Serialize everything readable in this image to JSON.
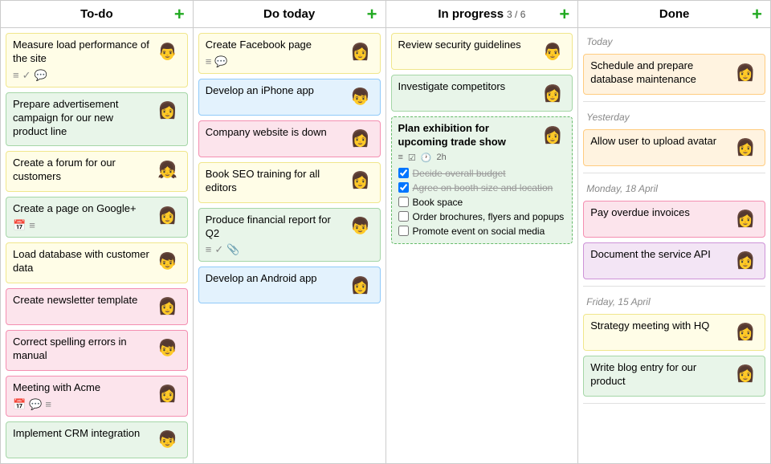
{
  "columns": [
    {
      "id": "todo",
      "label": "To-do",
      "badge": null,
      "cards": [
        {
          "id": "td1",
          "title": "Measure load performance of the site",
          "color": "yellow",
          "icons": [
            "list",
            "check",
            "bubble"
          ],
          "avatar": "👨"
        },
        {
          "id": "td2",
          "title": "Prepare advertisement campaign for our new product line",
          "color": "green",
          "icons": [],
          "avatar": "👩"
        },
        {
          "id": "td3",
          "title": "Create a forum for our customers",
          "color": "yellow",
          "icons": [],
          "avatar": "👧"
        },
        {
          "id": "td4",
          "title": "Create a page on Google+",
          "color": "green",
          "icons": [
            "calendar",
            "list"
          ],
          "avatar": "👩"
        },
        {
          "id": "td5",
          "title": "Load database with customer data",
          "color": "yellow",
          "icons": [],
          "avatar": "👦"
        },
        {
          "id": "td6",
          "title": "Create newsletter template",
          "color": "pink",
          "icons": [],
          "avatar": "👩"
        },
        {
          "id": "td7",
          "title": "Correct spelling errors in manual",
          "color": "pink",
          "icons": [],
          "avatar": "👦"
        },
        {
          "id": "td8",
          "title": "Meeting with Acme",
          "color": "pink",
          "icons": [
            "calendar",
            "bubble",
            "list"
          ],
          "avatar": "👩"
        },
        {
          "id": "td9",
          "title": "Implement CRM integration",
          "color": "green",
          "icons": [],
          "avatar": "👦"
        }
      ]
    },
    {
      "id": "dotoday",
      "label": "Do today",
      "badge": null,
      "cards": [
        {
          "id": "dt1",
          "title": "Create Facebook page",
          "color": "yellow",
          "icons": [
            "list",
            "bubble"
          ],
          "avatar": "👩"
        },
        {
          "id": "dt2",
          "title": "Develop an iPhone app",
          "color": "blue",
          "icons": [],
          "avatar": "👦"
        },
        {
          "id": "dt3",
          "title": "Company website is down",
          "color": "pink",
          "icons": [],
          "avatar": "👩"
        },
        {
          "id": "dt4",
          "title": "Book SEO training for all editors",
          "color": "yellow",
          "icons": [],
          "avatar": "👩"
        },
        {
          "id": "dt5",
          "title": "Produce financial report for Q2",
          "color": "green",
          "icons": [
            "list",
            "check",
            "clip"
          ],
          "avatar": "👦"
        },
        {
          "id": "dt6",
          "title": "Develop an Android app",
          "color": "blue",
          "icons": [],
          "avatar": "👩"
        }
      ]
    },
    {
      "id": "inprogress",
      "label": "In progress",
      "badge": "3 / 6",
      "cards": [
        {
          "id": "ip1",
          "title": "Review security guidelines",
          "color": "yellow",
          "icons": [],
          "avatar": "👨"
        },
        {
          "id": "ip2",
          "title": "Investigate competitors",
          "color": "green",
          "icons": [],
          "avatar": "👩"
        },
        {
          "id": "ip3",
          "title": "Plan exhibition for upcoming trade show",
          "color": "inprogress-big",
          "meta": [
            "list",
            "check",
            "clock",
            "2h"
          ],
          "avatar": "👩",
          "checklist": [
            {
              "text": "Decide overall budget",
              "done": true
            },
            {
              "text": "Agree on booth size and location",
              "done": true
            },
            {
              "text": "Book space",
              "done": false
            },
            {
              "text": "Order brochures, flyers and popups",
              "done": false
            },
            {
              "text": "Promote event on social media",
              "done": false
            }
          ]
        }
      ]
    },
    {
      "id": "done",
      "label": "Done",
      "badge": null,
      "sections": [
        {
          "label": "Today",
          "cards": [
            {
              "id": "dn1",
              "title": "Schedule and prepare database maintenance",
              "color": "orange",
              "avatar": "👩"
            }
          ]
        },
        {
          "label": "Yesterday",
          "cards": [
            {
              "id": "dn2",
              "title": "Allow user to upload avatar",
              "color": "orange",
              "avatar": "👩"
            }
          ]
        },
        {
          "label": "Monday, 18 April",
          "cards": [
            {
              "id": "dn3",
              "title": "Pay overdue invoices",
              "color": "pink",
              "avatar": "👩"
            },
            {
              "id": "dn4",
              "title": "Document the service API",
              "color": "purple",
              "avatar": "👩"
            }
          ]
        },
        {
          "label": "Friday, 15 April",
          "cards": [
            {
              "id": "dn5",
              "title": "Strategy meeting with HQ",
              "color": "yellow",
              "avatar": "👩"
            },
            {
              "id": "dn6",
              "title": "Write blog entry for our product",
              "color": "green",
              "avatar": "👩"
            }
          ]
        }
      ]
    }
  ],
  "icons": {
    "list": "≡",
    "check": "✓",
    "bubble": "💬",
    "calendar": "📅",
    "clip": "📎",
    "clock": "🕐",
    "plus": "+"
  }
}
